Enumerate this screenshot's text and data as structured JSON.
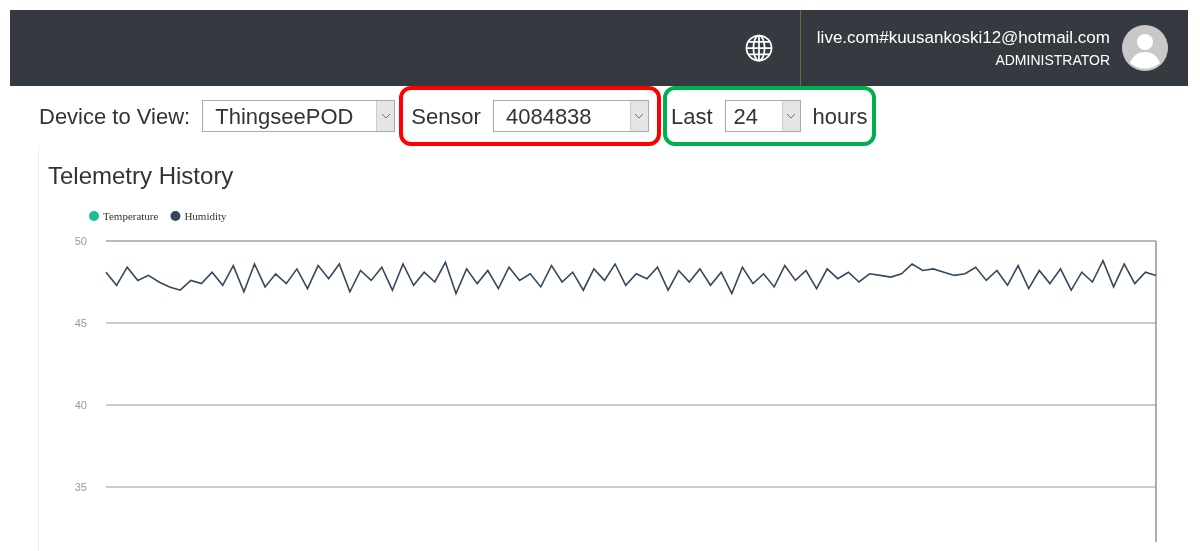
{
  "header": {
    "user_email": "live.com#kuusankoski12@hotmail.com",
    "user_role": "ADMINISTRATOR"
  },
  "filters": {
    "device_label": "Device to View:",
    "device_value": "ThingseePOD",
    "sensor_label": "Sensor",
    "sensor_value": "4084838",
    "last_label": "Last",
    "hours_value": "24",
    "hours_label": "hours"
  },
  "highlights": [
    {
      "color": "#ff0000"
    },
    {
      "color": "#00b050"
    }
  ],
  "panel": {
    "title": "Telemetry History",
    "chart_data": {
      "type": "line",
      "grid": true,
      "ylim": [
        31.6,
        50
      ],
      "yticks": [
        50,
        45,
        40,
        35
      ],
      "series": [
        {
          "name": "Temperature",
          "color": "#1abc9c"
        },
        {
          "name": "Humidity",
          "color": "#34495e",
          "values": [
            48.1,
            47.3,
            48.4,
            47.6,
            47.9,
            47.5,
            47.2,
            47.0,
            47.6,
            47.4,
            48.1,
            47.3,
            48.5,
            46.9,
            48.6,
            47.2,
            48.0,
            47.4,
            48.3,
            47.1,
            48.5,
            47.7,
            48.6,
            46.9,
            48.2,
            47.6,
            48.4,
            47.0,
            48.6,
            47.3,
            48.1,
            47.5,
            48.7,
            46.8,
            48.3,
            47.4,
            48.2,
            47.1,
            48.4,
            47.6,
            48.0,
            47.2,
            48.5,
            47.5,
            48.1,
            47.0,
            48.3,
            47.6,
            48.6,
            47.3,
            48.0,
            47.7,
            48.4,
            47.0,
            48.2,
            47.5,
            48.3,
            47.3,
            48.1,
            46.8,
            48.4,
            47.4,
            48.0,
            47.2,
            48.5,
            47.6,
            48.2,
            47.1,
            48.3,
            47.7,
            48.1,
            47.5,
            48.0,
            47.9,
            47.8,
            48.0,
            48.6,
            48.2,
            48.3,
            48.1,
            47.9,
            48.0,
            48.4,
            47.6,
            48.2,
            47.3,
            48.5,
            47.1,
            48.2,
            47.4,
            48.3,
            47.0,
            48.1,
            47.5,
            48.8,
            47.2,
            48.6,
            47.4,
            48.1,
            47.9
          ]
        }
      ]
    }
  }
}
